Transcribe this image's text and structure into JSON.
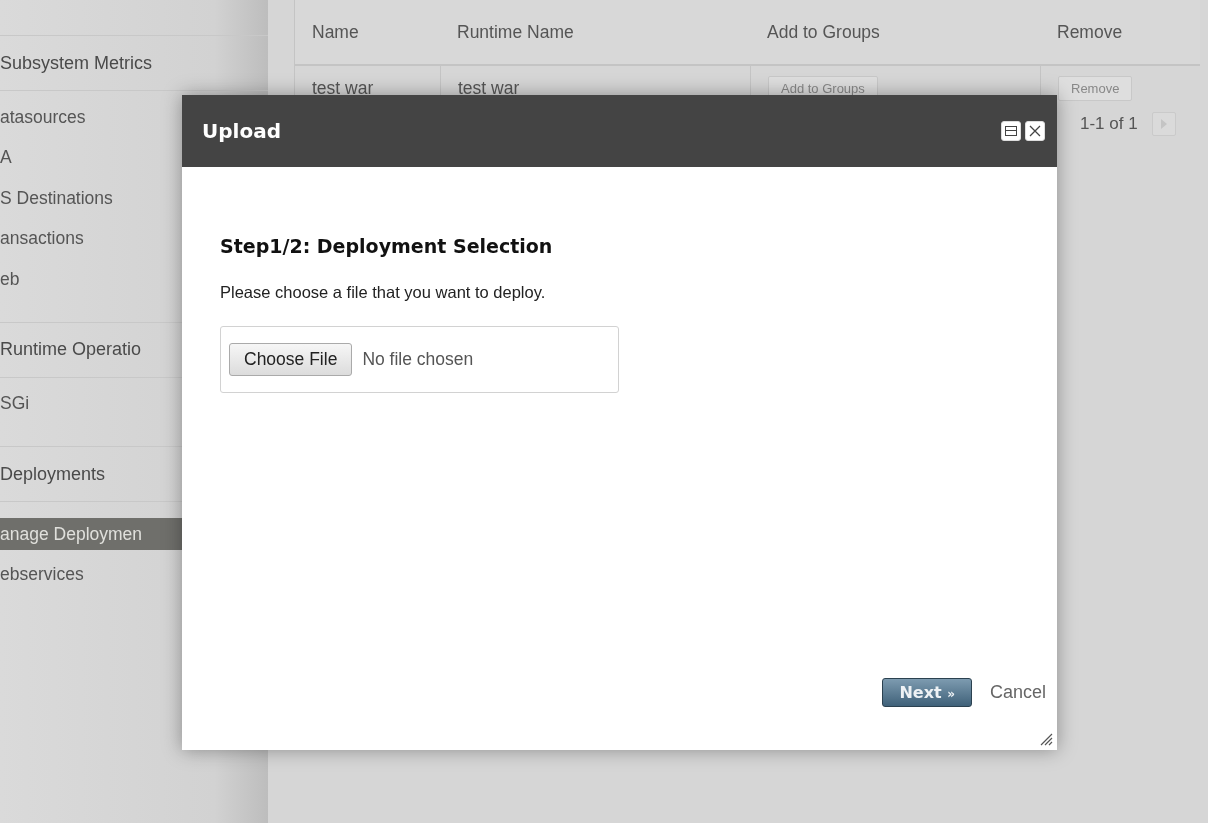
{
  "sidebar": {
    "sections": [
      {
        "header": "Subsystem Metrics",
        "items": [
          {
            "label": "atasources",
            "selected": false
          },
          {
            "label": "A",
            "selected": false
          },
          {
            "label": "S Destinations",
            "selected": false
          },
          {
            "label": "ansactions",
            "selected": false
          },
          {
            "label": "eb",
            "selected": false
          }
        ]
      },
      {
        "header": "Runtime Operatio",
        "items": [
          {
            "label": "SGi",
            "selected": false
          }
        ]
      },
      {
        "header": "Deployments",
        "items": [
          {
            "label": "anage Deploymen",
            "selected": true
          },
          {
            "label": "ebservices",
            "selected": false
          }
        ]
      }
    ]
  },
  "table": {
    "columns": [
      "Name",
      "Runtime Name",
      "Add to Groups",
      "Remove"
    ],
    "rows": [
      {
        "name": "test war",
        "runtime_name": "test war",
        "add_button": "Add to Groups",
        "remove_button": "Remove"
      }
    ],
    "pager": "1-1 of 1"
  },
  "dialog": {
    "title": "Upload",
    "heading": "Step1/2: Deployment Selection",
    "instruction": "Please choose a file that you want to deploy.",
    "choose_button": "Choose File",
    "file_status": "No file chosen",
    "next_button": "Next",
    "next_mark": "»",
    "cancel": "Cancel"
  }
}
